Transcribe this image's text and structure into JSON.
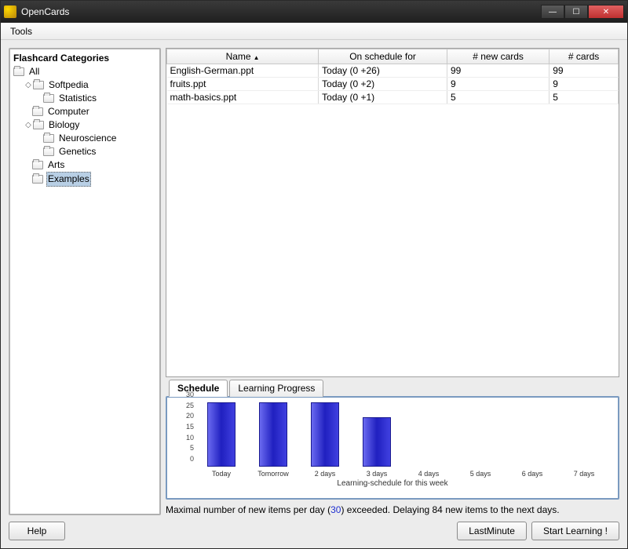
{
  "window": {
    "title": "OpenCards"
  },
  "menubar": {
    "tools": "Tools"
  },
  "sidebar": {
    "title": "Flashcard Categories",
    "tree": {
      "root": "All",
      "nodes": [
        {
          "label": "Softpedia",
          "expandable": true,
          "children": [
            "Statistics"
          ]
        },
        {
          "label": "Computer",
          "expandable": false
        },
        {
          "label": "Biology",
          "expandable": true,
          "children": [
            "Neuroscience",
            "Genetics"
          ]
        },
        {
          "label": "Arts",
          "expandable": false
        },
        {
          "label": "Examples",
          "expandable": false,
          "selected": true
        }
      ]
    }
  },
  "table": {
    "headers": {
      "name": "Name",
      "schedule": "On schedule for",
      "new_cards": "# new cards",
      "cards": "# cards"
    },
    "sort_asc_on": "name",
    "rows": [
      {
        "name": "English-German.ppt",
        "schedule": "Today (0 +26)",
        "new_cards": "99",
        "cards": "99"
      },
      {
        "name": "fruits.ppt",
        "schedule": "Today (0 +2)",
        "new_cards": "9",
        "cards": "9"
      },
      {
        "name": "math-basics.ppt",
        "schedule": "Today (0 +1)",
        "new_cards": "5",
        "cards": "5"
      }
    ]
  },
  "tabs": {
    "schedule": "Schedule",
    "progress": "Learning Progress",
    "active": "schedule"
  },
  "chart_data": {
    "type": "bar",
    "categories": [
      "Today",
      "Tomorrow",
      "2 days",
      "3 days",
      "4 days",
      "5 days",
      "6 days",
      "7 days"
    ],
    "values": [
      30,
      30,
      30,
      23,
      0,
      0,
      0,
      0
    ],
    "title": "Learning-schedule for this week",
    "xlabel": "",
    "ylabel": "",
    "ylim": [
      0,
      30
    ],
    "yticks": [
      0,
      5,
      10,
      15,
      20,
      25,
      30
    ]
  },
  "status": {
    "prefix": "Maximal number of new items per day (",
    "limit": "30",
    "suffix": ") exceeded. Delaying 84 new items to the next days."
  },
  "footer": {
    "help": "Help",
    "lastminute": "LastMinute",
    "start": "Start Learning !"
  }
}
